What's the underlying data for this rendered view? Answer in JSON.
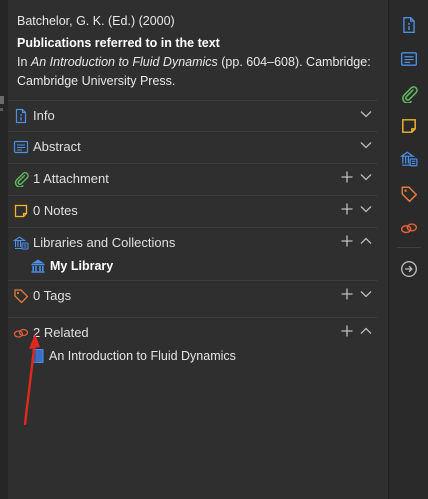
{
  "header": {
    "creator_line": "Batchelor, G. K. (Ed.) (2000)",
    "title": "Publications referred to in the text",
    "cite_prefix": "In ",
    "cite_book": "An Introduction to Fluid Dynamics",
    "cite_suffix": " (pp. 604–608). Cambridge:",
    "cite_line2": "Cambridge University Press."
  },
  "sections": {
    "info": {
      "label": "Info"
    },
    "abstract": {
      "label": "Abstract"
    },
    "attachments": {
      "label": "1 Attachment"
    },
    "notes": {
      "label": "0 Notes"
    },
    "libraries": {
      "label": "Libraries and Collections",
      "items": [
        "My Library"
      ]
    },
    "tags": {
      "label": "0 Tags"
    },
    "related": {
      "label": "2 Related",
      "items": [
        "An Introduction to Fluid Dynamics"
      ]
    }
  },
  "colors": {
    "accent_blue": "#4a8fe8",
    "attachment_green": "#5fb95a",
    "notes_yellow": "#f2b52b",
    "tags_orange": "#e67a3c",
    "related_orange": "#e05d3a",
    "annotation_arrow_red": "#e0281e"
  },
  "icons": {
    "sidenav": [
      "info-icon",
      "abstract-icon",
      "attachment-icon",
      "notes-icon",
      "libraries-icon",
      "tags-icon",
      "related-icon",
      "locate-icon"
    ]
  }
}
